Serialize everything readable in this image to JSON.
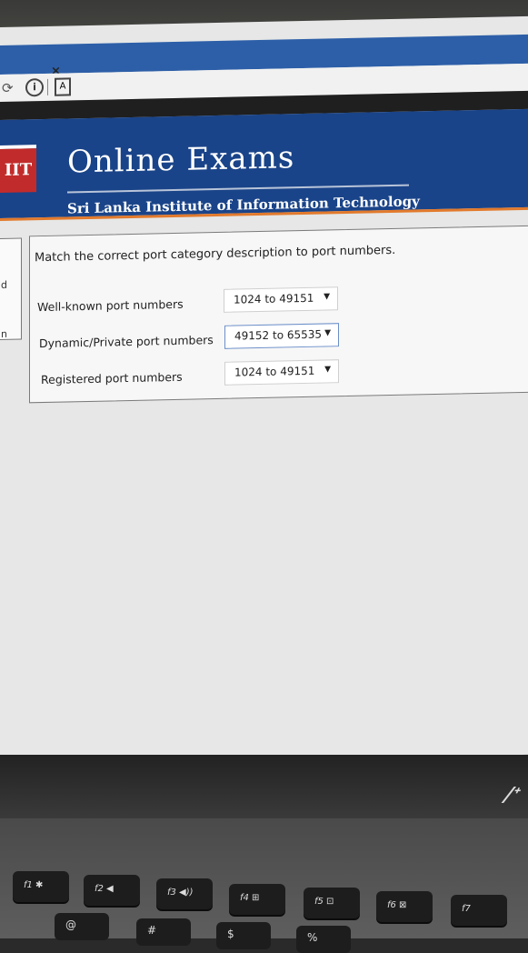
{
  "browser": {
    "tab_close": "×",
    "info_icon": "i",
    "doc_icon": "A"
  },
  "header": {
    "logo_text": "IIT",
    "title": "Online Exams",
    "subtitle": "Sri Lanka Institute of Information Technology",
    "colors": {
      "band": "#1a4489",
      "accent": "#e27a2c"
    }
  },
  "left_fragment": {
    "letters": [
      "d",
      "n"
    ]
  },
  "question": {
    "prompt": "Match the correct port category description to port numbers.",
    "rows": [
      {
        "label": "Well-known port numbers",
        "selected": "1024 to 49151"
      },
      {
        "label": "Dynamic/Private port numbers",
        "selected": "49152 to 65535"
      },
      {
        "label": "Registered port numbers",
        "selected": "1024 to 49151"
      }
    ],
    "caret": "▼"
  },
  "laptop": {
    "brand": "/ᐩ",
    "fkeys": [
      "f1 ✱",
      "f2 ◀",
      "f3 ◀))",
      "f4 ⊞",
      "f5 ⊡",
      "f6 ⊠",
      "f7"
    ],
    "numkeys": [
      "@",
      "#",
      "$",
      "%"
    ]
  }
}
